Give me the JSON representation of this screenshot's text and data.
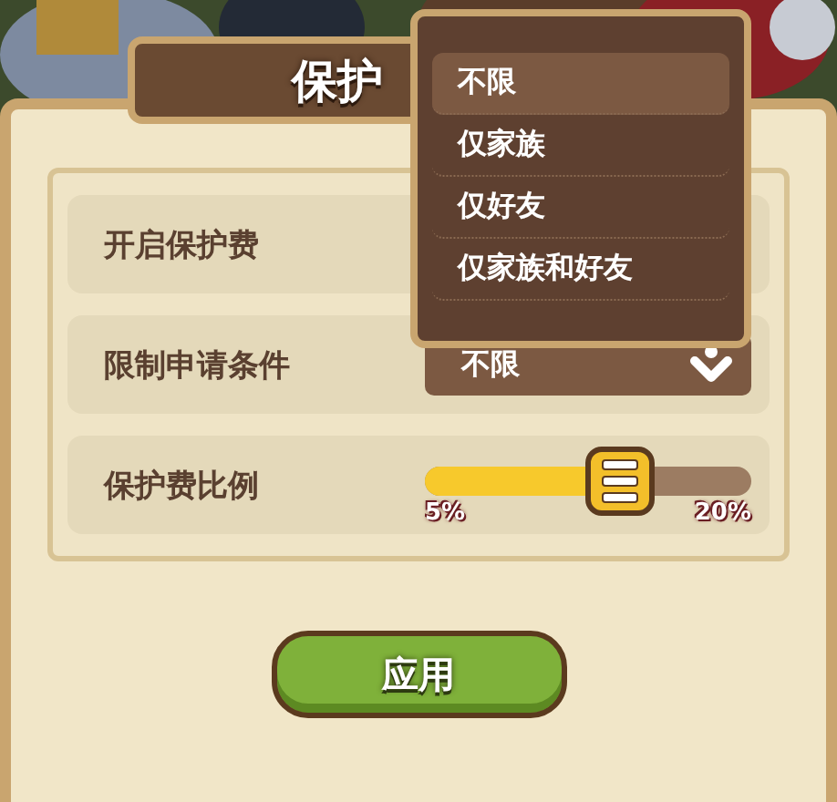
{
  "dialog": {
    "title": "保护"
  },
  "rows": [
    {
      "kind": "toggle",
      "label": "开启保护费"
    },
    {
      "kind": "dropdown",
      "label": "限制申请条件",
      "value": "不限"
    },
    {
      "kind": "slider",
      "label": "保护费比例",
      "level": 0.6,
      "min_label": "5%",
      "max_label": "20%"
    }
  ],
  "dropdown_menu": {
    "options": [
      {
        "label": "不限",
        "selected": true
      },
      {
        "label": "仅家族",
        "selected": false
      },
      {
        "label": "仅好友",
        "selected": false
      },
      {
        "label": "仅家族和好友",
        "selected": false
      }
    ]
  },
  "apply_button": {
    "label": "应用"
  }
}
